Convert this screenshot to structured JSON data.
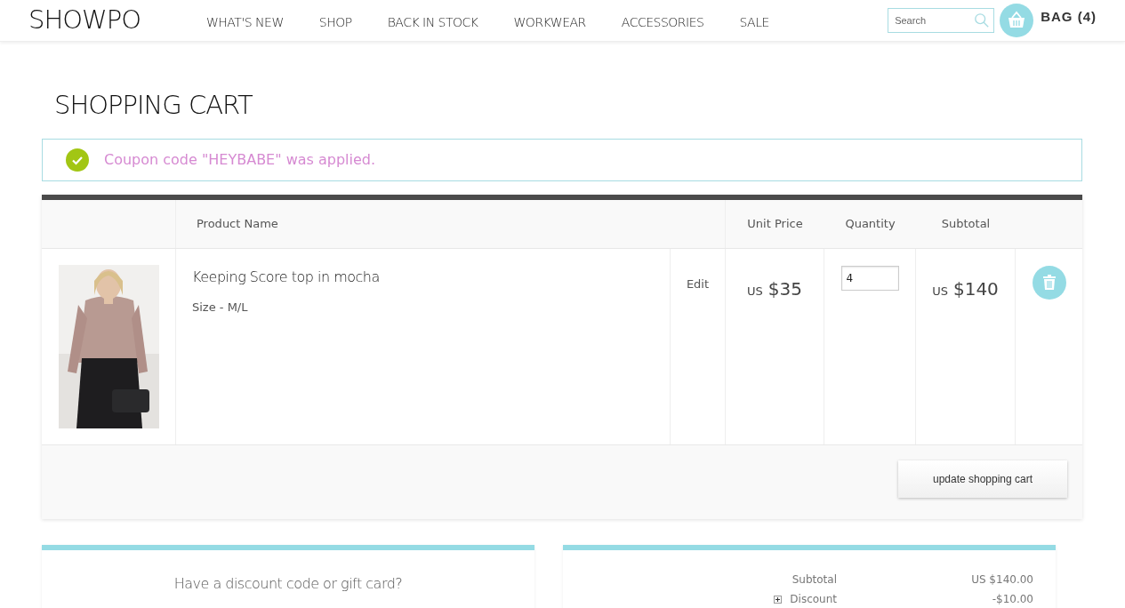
{
  "header": {
    "logo": "SHOWPO",
    "nav": [
      {
        "label": "WHAT'S NEW"
      },
      {
        "label": "SHOP"
      },
      {
        "label": "BACK IN STOCK"
      },
      {
        "label": "WORKWEAR"
      },
      {
        "label": "ACCESSORIES"
      },
      {
        "label": "SALE"
      }
    ],
    "search": {
      "placeholder": "Search"
    },
    "bag": "BAG (4)"
  },
  "page_title": "SHOPPING CART",
  "alert": {
    "message": "Coupon code \"HEYBABE\" was applied."
  },
  "table": {
    "columns": [
      "Product Name",
      "Unit Price",
      "Quantity",
      "Subtotal"
    ],
    "rows": [
      {
        "name": "Keeping Score top in mocha",
        "option": "Size - M/L",
        "edit": "Edit",
        "unit_currency": "US",
        "unit_price": "$35",
        "quantity": "4",
        "subtotal_currency": "US",
        "subtotal": "$140"
      }
    ],
    "update_button": "update shopping cart"
  },
  "discount_card": {
    "title": "Have a discount code or gift card?"
  },
  "totals": [
    {
      "label": "Subtotal",
      "value": "US $140.00",
      "expandable": false
    },
    {
      "label": "Discount",
      "value": "-$10.00",
      "expandable": true
    }
  ]
}
